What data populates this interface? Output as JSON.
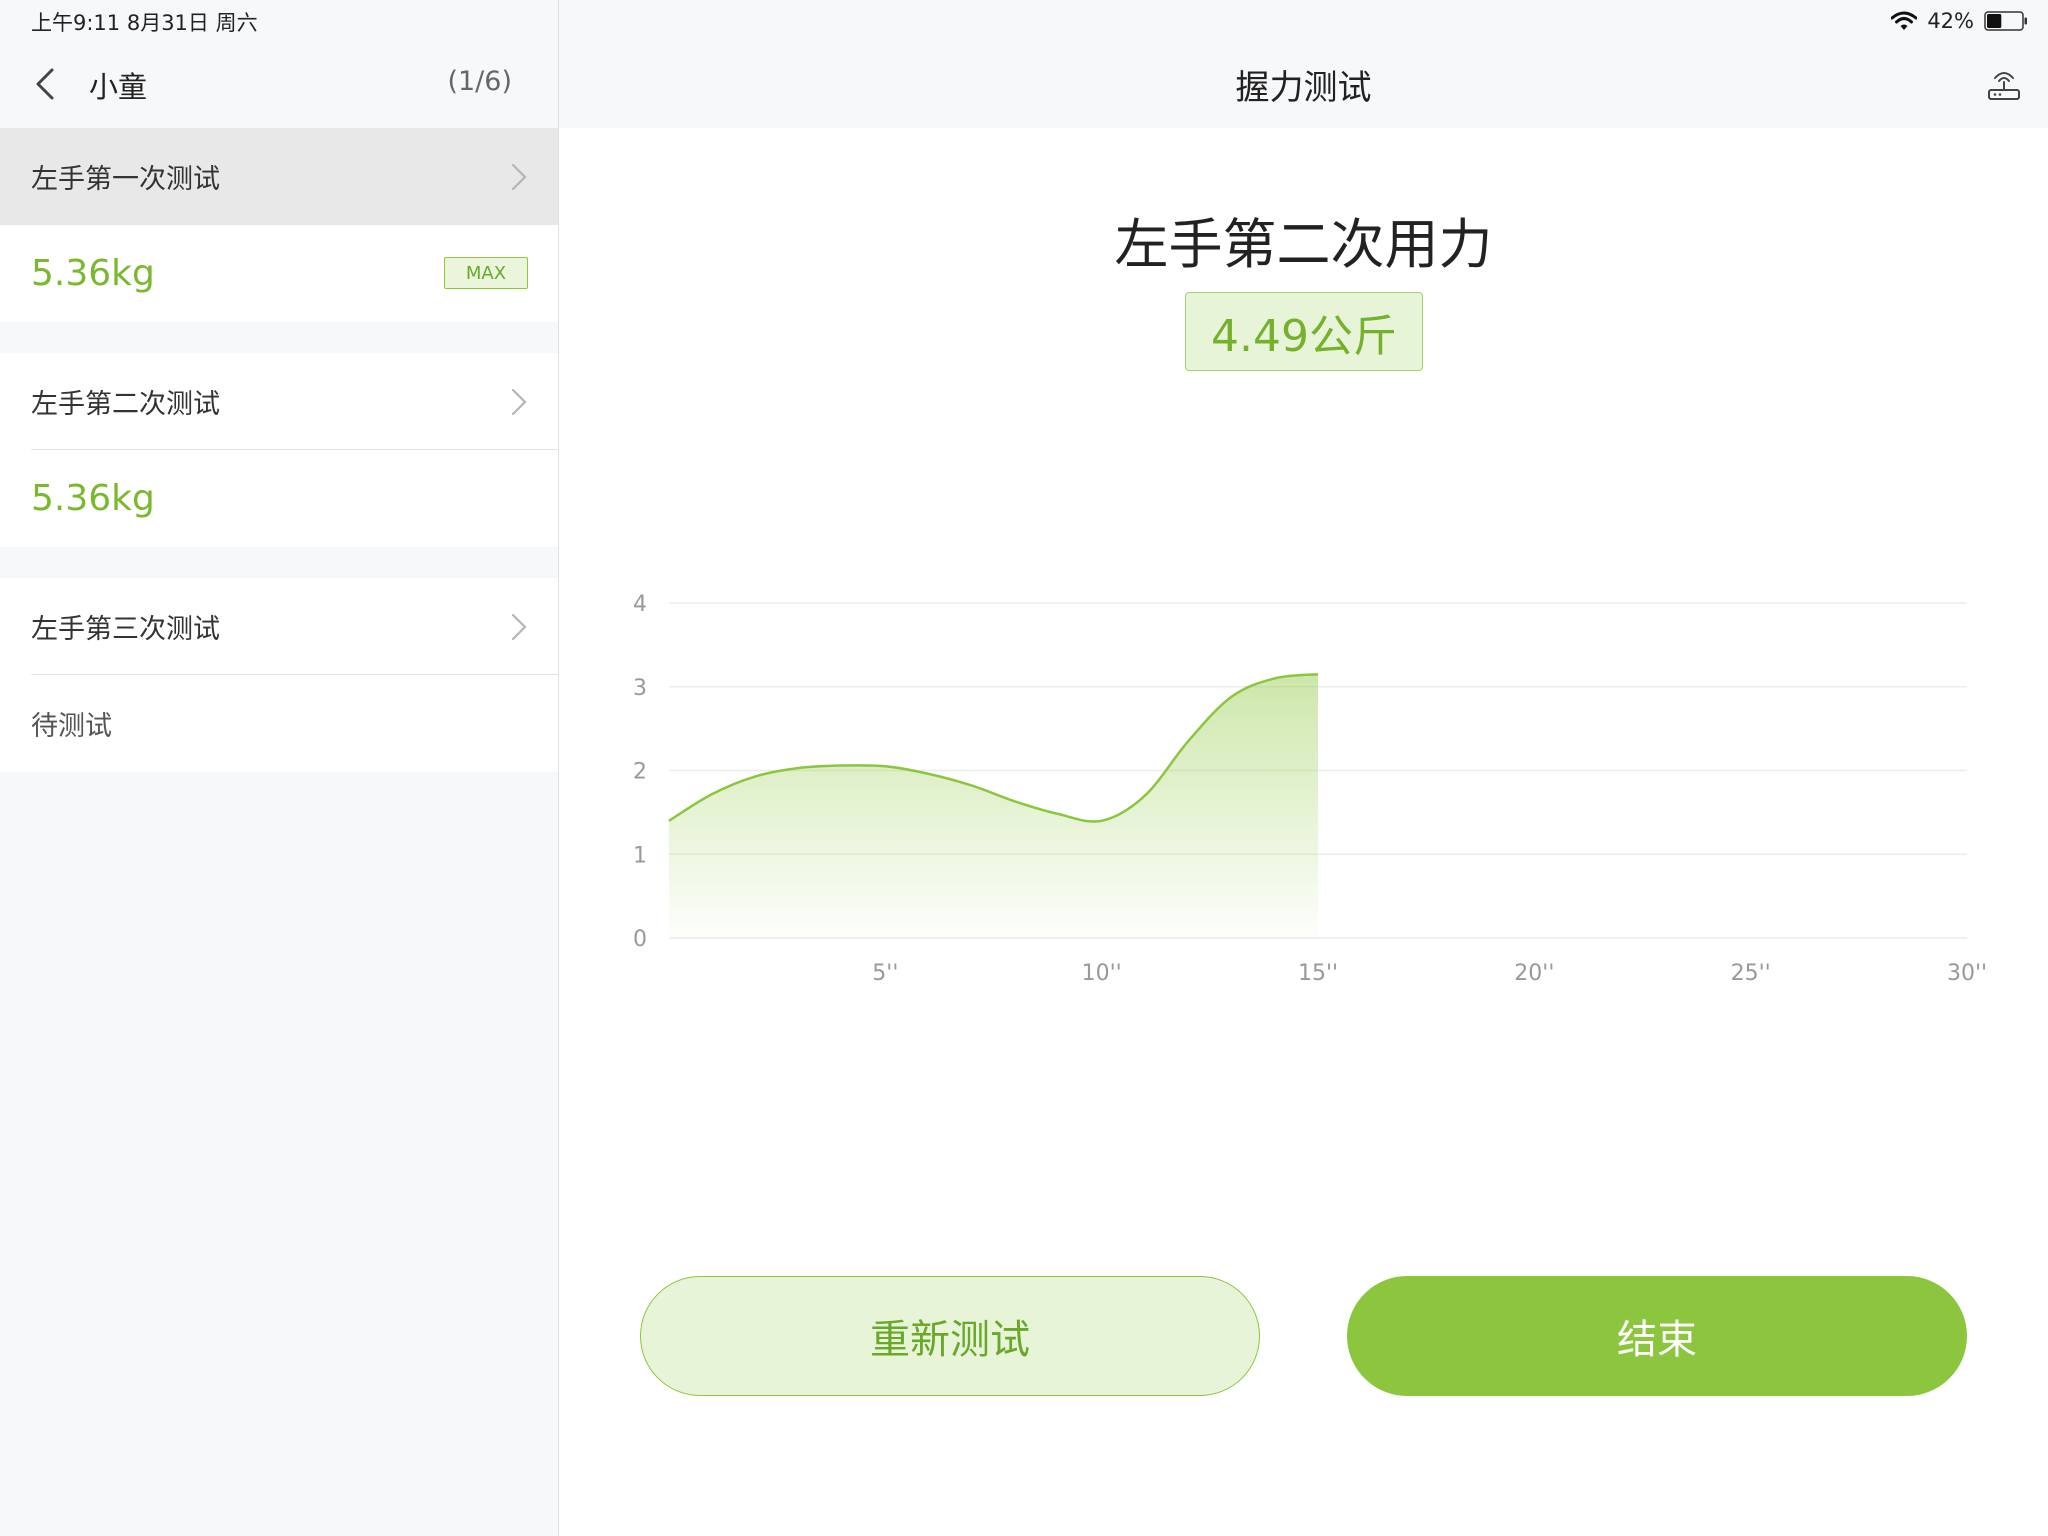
{
  "status": {
    "time_date": "上午9:11  8月31日 周六",
    "battery": "42%",
    "battery_level": 0.42,
    "icons": [
      "wifi-icon",
      "battery-icon"
    ]
  },
  "sidebar": {
    "student_name": "小童",
    "page_count": "(1/6)",
    "tests": [
      {
        "label": "左手第一次测试",
        "value": "5.36kg",
        "badge": "MAX",
        "selected": true
      },
      {
        "label": "左手第二次测试",
        "value": "5.36kg",
        "selected": false
      },
      {
        "label": "左手第三次测试",
        "value": "待测试",
        "selected": false
      }
    ]
  },
  "main": {
    "nav_title": "握力测试",
    "attempt_title": "左手第二次用力",
    "result": "4.49公斤"
  },
  "buttons": {
    "retest": "重新测试",
    "finish": "结束"
  },
  "colors": {
    "accent": "#8cc63e",
    "accent_text": "#74b22c",
    "accent_light": "#e7f4d8"
  },
  "chart_data": {
    "type": "area",
    "x": [
      0,
      1,
      2,
      3,
      4,
      5,
      6,
      7,
      8,
      9,
      10,
      11,
      12,
      13,
      14,
      15
    ],
    "values": [
      1.4,
      1.72,
      1.93,
      2.03,
      2.06,
      2.05,
      1.96,
      1.82,
      1.63,
      1.48,
      1.4,
      1.7,
      2.35,
      2.88,
      3.1,
      3.15
    ],
    "x_ticks": [
      "5''",
      "10''",
      "15''",
      "20''",
      "25''",
      "30''"
    ],
    "x_tick_values": [
      5,
      10,
      15,
      20,
      25,
      30
    ],
    "y_ticks": [
      "0",
      "1",
      "2",
      "3",
      "4"
    ],
    "xlim": [
      0,
      30
    ],
    "ylim": [
      0,
      4
    ],
    "grid": true,
    "xlabel": "",
    "ylabel": ""
  }
}
